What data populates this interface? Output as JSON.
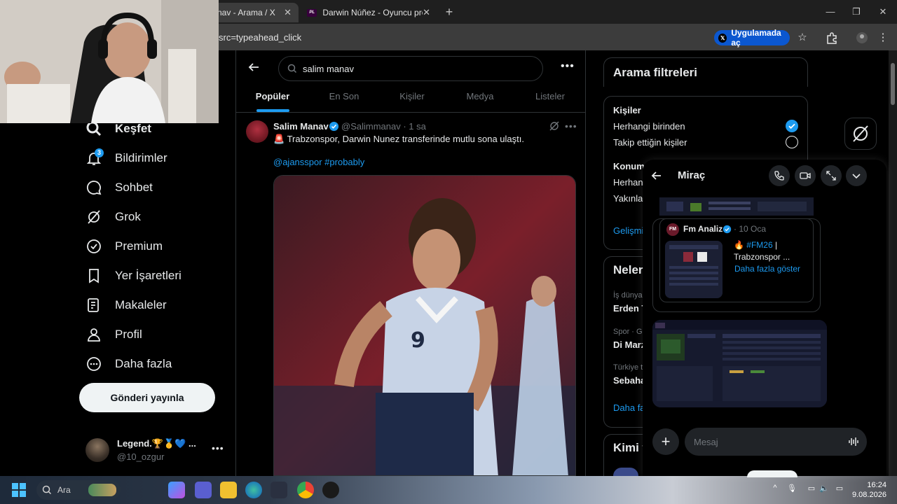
{
  "browser": {
    "tabs": [
      {
        "title": "nav - Arama / X",
        "active": true
      },
      {
        "title": "Darwin Núñez - Oyuncu profili",
        "active": false
      }
    ],
    "url_fragment": "src=typeahead_click",
    "app_button": "Uygulamada aç"
  },
  "nav": {
    "items": [
      {
        "label": "Keşfet",
        "icon": "search-icon"
      },
      {
        "label": "Bildirimler",
        "icon": "bell-icon"
      },
      {
        "label": "Sohbet",
        "icon": "chat-icon"
      },
      {
        "label": "Grok",
        "icon": "grok-icon"
      },
      {
        "label": "Premium",
        "icon": "premium-icon"
      },
      {
        "label": "Yer İşaretleri",
        "icon": "bookmark-icon"
      },
      {
        "label": "Makaleler",
        "icon": "article-icon"
      },
      {
        "label": "Profil",
        "icon": "person-icon"
      },
      {
        "label": "Daha fazla",
        "icon": "more-circle-icon"
      }
    ],
    "notifications_badge": "3",
    "post_button": "Gönderi yayınla",
    "account": {
      "name": "Legend.🏆🥇💙 ...",
      "handle": "@10_ozgur"
    }
  },
  "search": {
    "query": "salim manav",
    "tabs": [
      "Popüler",
      "En Son",
      "Kişiler",
      "Medya",
      "Listeler"
    ],
    "active_tab": 0
  },
  "post": {
    "name": "Salim Manav",
    "handle": "@Salimmanav · 1 sa",
    "text": "🚨 Trabzonspor, Darwin Nunez transferinde mutlu sona ulaştı.",
    "tags": "@ajansspor #probably"
  },
  "filters": {
    "title": "Arama filtreleri",
    "people_label": "Kişiler",
    "people_options": [
      "Herhangi birinden",
      "Takip ettiğin kişiler"
    ],
    "people_selected": 0,
    "location_label": "Konum",
    "location_options": [
      "Herhan",
      "Yakınla"
    ],
    "advanced": "Gelişmi"
  },
  "trends": {
    "title": "Neler",
    "items": [
      {
        "meta": "İş dünya",
        "name": "Erden T"
      },
      {
        "meta": "Spor · Gü",
        "name": "Di Marz"
      },
      {
        "meta": "Türkiye t",
        "name": "Sebaha"
      }
    ],
    "show_more": "Daha fa"
  },
  "who_to_follow": {
    "title": "Kimi t"
  },
  "chat": {
    "contact": "Miraç",
    "quote": {
      "avatar_text": "FM",
      "name": "Fm Analiz",
      "date": "· 10 Oca",
      "emoji": "🔥",
      "hashtag": "#FM26",
      "suffix": " |",
      "line2": "Trabzonspor ...",
      "more": "Daha fazla göster"
    },
    "input_placeholder": "Mesaj"
  },
  "taskbar": {
    "search_label": "Ara",
    "time": "16:24",
    "date": "9.08.2026"
  }
}
